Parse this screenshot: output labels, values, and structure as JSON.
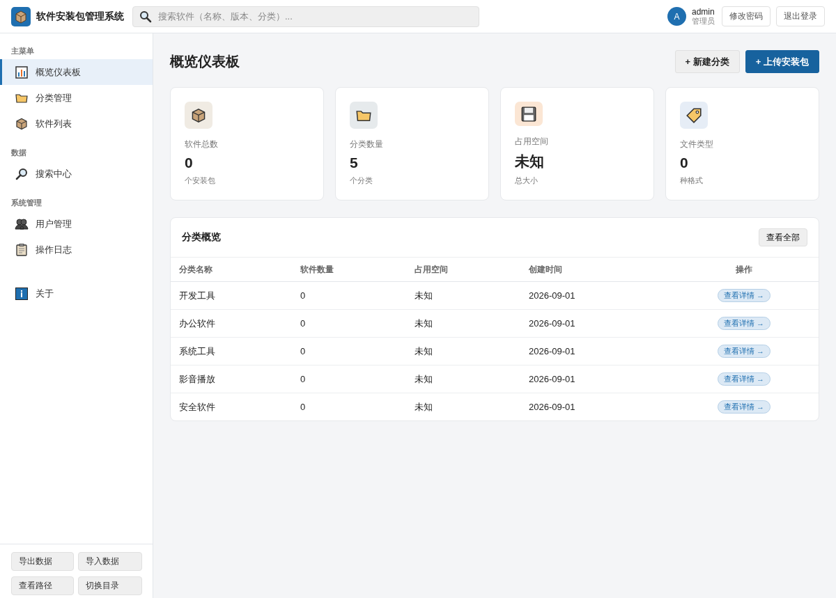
{
  "app": {
    "title": "软件安装包管理系统"
  },
  "search": {
    "placeholder": "搜索软件（名称、版本、分类）..."
  },
  "user": {
    "avatar": "A",
    "name": "admin",
    "role": "管理员"
  },
  "header_buttons": [
    "修改密码",
    "退出登录"
  ],
  "sidebar": {
    "sections": [
      {
        "title": "主菜单",
        "items": [
          {
            "label": "概览仪表板",
            "selected": true
          },
          {
            "label": "分类管理",
            "selected": false
          },
          {
            "label": "软件列表",
            "selected": false
          }
        ]
      },
      {
        "title": "数据",
        "items": [
          {
            "label": "搜索中心",
            "selected": false
          }
        ]
      },
      {
        "title": "系统管理",
        "items": [
          {
            "label": "用户管理",
            "selected": false
          },
          {
            "label": "操作日志",
            "selected": false
          }
        ]
      },
      {
        "items": [
          {
            "label": "关于",
            "selected": false
          }
        ]
      }
    ],
    "footer_buttons": [
      "导出数据",
      "导入数据",
      "查看路径",
      "切换目录"
    ]
  },
  "page": {
    "title": "概览仪表板",
    "actions": [
      {
        "label": "+ 新建分类",
        "kind": "secondary"
      },
      {
        "label": "+ 上传安装包",
        "kind": "primary"
      }
    ]
  },
  "stats": [
    {
      "label": "软件总数",
      "value": "0",
      "unit": "个安装包"
    },
    {
      "label": "分类数量",
      "value": "5",
      "unit": "个分类"
    },
    {
      "label": "占用空间",
      "value": "未知",
      "unit": "总大小"
    },
    {
      "label": "文件类型",
      "value": "0",
      "unit": "种格式"
    }
  ],
  "table": {
    "title": "分类概览",
    "view_all": "查看全部",
    "columns": [
      "分类名称",
      "软件数量",
      "占用空间",
      "创建时间",
      "操作"
    ],
    "rows": [
      {
        "name": "开发工具",
        "count": "0",
        "size": "未知",
        "created": "2026-09-01",
        "action": "查看详情 →"
      },
      {
        "name": "办公软件",
        "count": "0",
        "size": "未知",
        "created": "2026-09-01",
        "action": "查看详情 →"
      },
      {
        "name": "系统工具",
        "count": "0",
        "size": "未知",
        "created": "2026-09-01",
        "action": "查看详情 →"
      },
      {
        "name": "影音播放",
        "count": "0",
        "size": "未知",
        "created": "2026-09-01",
        "action": "查看详情 →"
      },
      {
        "name": "安全软件",
        "count": "0",
        "size": "未知",
        "created": "2026-09-01",
        "action": "查看详情 →"
      }
    ]
  }
}
